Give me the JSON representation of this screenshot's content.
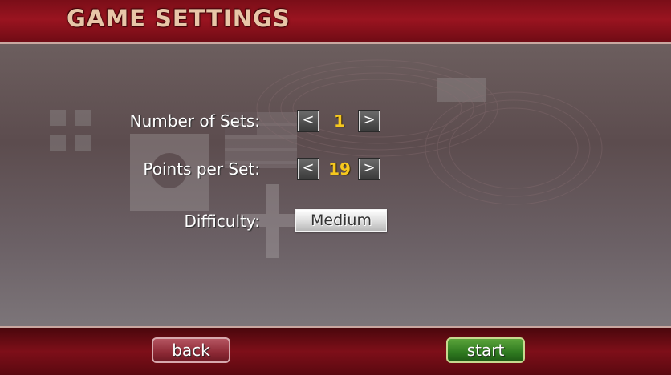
{
  "header": {
    "title": "GAME SETTINGS"
  },
  "settings": {
    "sets": {
      "label": "Number of Sets:",
      "value": "1",
      "prev_glyph": "<",
      "next_glyph": ">"
    },
    "points": {
      "label": "Points per Set:",
      "value": "19",
      "prev_glyph": "<",
      "next_glyph": ">"
    },
    "difficulty": {
      "label": "Difficulty:",
      "value": "Medium"
    }
  },
  "footer": {
    "back_label": "back",
    "start_label": "start"
  },
  "colors": {
    "accent_value": "#f6c81e",
    "header_bg": "#9a1420",
    "back_button": "#8e2a36",
    "start_button": "#2f7a20"
  }
}
